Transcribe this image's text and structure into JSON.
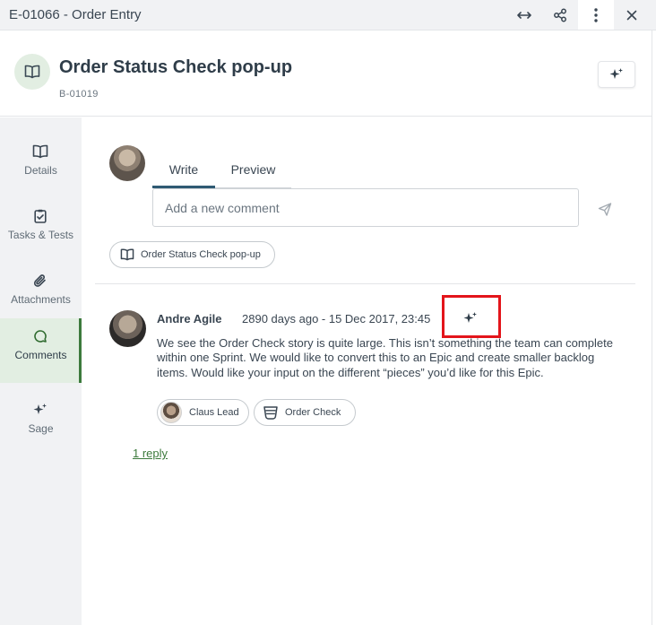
{
  "window": {
    "title": "E-01066 - Order Entry",
    "actions": [
      {
        "icon": "expand-horizontal-icon"
      },
      {
        "icon": "share-icon"
      },
      {
        "icon": "more-vertical-icon"
      },
      {
        "icon": "close-icon"
      }
    ]
  },
  "header": {
    "icon": "book-icon",
    "title": "Order Status Check pop-up",
    "id": "B-01019",
    "sage_button_icon": "sparkle-icon"
  },
  "sidebar": {
    "items": [
      {
        "label": "Details",
        "icon": "book-icon",
        "active": false
      },
      {
        "label": "Tasks & Tests",
        "icon": "task-check-icon",
        "active": false
      },
      {
        "label": "Attachments",
        "icon": "paperclip-icon",
        "active": false
      },
      {
        "label": "Comments",
        "icon": "comment-icon",
        "active": true
      },
      {
        "label": "Sage",
        "icon": "sparkle-icon",
        "active": false
      }
    ]
  },
  "composer": {
    "tabs": [
      {
        "label": "Write",
        "active": true
      },
      {
        "label": "Preview",
        "active": false
      }
    ],
    "input_value": "",
    "input_placeholder": "Add a new comment",
    "context_chip": {
      "label": "Order Status Check pop-up",
      "icon": "book-icon"
    }
  },
  "comment": {
    "author": "Andre Agile",
    "timestamp": "2890 days ago - 15 Dec 2017, 23:45",
    "body": "We see the Order Check story is quite large. This isn’t something the team can complete within one Sprint. We would like to convert this to an Epic and create smaller backlog items. Would like your input on the different “pieces” you’d like for this Epic.",
    "mentions": [
      {
        "label": "Claus Lead",
        "type": "member"
      },
      {
        "label": "Order Check",
        "type": "epic",
        "icon": "epic-icon"
      }
    ],
    "reply_link": "1 reply"
  },
  "colors": {
    "accent_green": "#3c7a3c",
    "active_bg": "#e2eee2",
    "highlight_box": "#e3151b",
    "sidebar_bg": "#f1f2f4"
  }
}
